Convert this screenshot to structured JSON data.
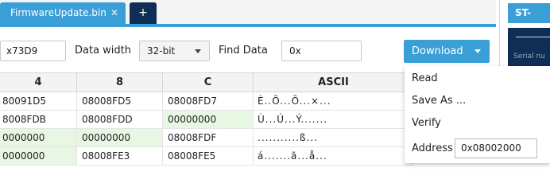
{
  "tabs": {
    "active_label": "FirmwareUpdate.bin",
    "close_glyph": "✕",
    "add_glyph": "+"
  },
  "side_panel": {
    "header": "ST-LINK",
    "subtext": "Serial nu"
  },
  "toolbar": {
    "address_value": "x73D9",
    "data_width_label": "Data width",
    "data_width_value": "32-bit",
    "find_data_label": "Find Data",
    "find_data_value": "0x",
    "download_label": "Download"
  },
  "grid": {
    "headers": [
      "4",
      "8",
      "C",
      "ASCII"
    ],
    "rows": [
      {
        "c4": "80091D5",
        "c8": "08008FD5",
        "cC": "08008FD7",
        "ascii": "È..Õ...Õ...×...",
        "g4": false,
        "g8": false,
        "gC": false
      },
      {
        "c4": "8008FDB",
        "c8": "08008FDD",
        "cC": "00000000",
        "ascii": "Ù...Ú...Ý.......",
        "g4": false,
        "g8": false,
        "gC": true
      },
      {
        "c4": "0000000",
        "c8": "00000000",
        "cC": "08008FDF",
        "ascii": "...........ß...",
        "g4": true,
        "g8": true,
        "gC": false
      },
      {
        "c4": "0000000",
        "c8": "08008FE3",
        "cC": "08008FE5",
        "ascii": "á.......ã...å...",
        "g4": true,
        "g8": false,
        "gC": false
      }
    ]
  },
  "menu": {
    "items": [
      "Read",
      "Save As ...",
      "Verify"
    ],
    "address_label": "Address",
    "address_value": "0x08002000"
  },
  "colors": {
    "accent": "#3a9fd6",
    "dark_navy": "#0f2e55",
    "match_green": "#e8f7e3"
  }
}
